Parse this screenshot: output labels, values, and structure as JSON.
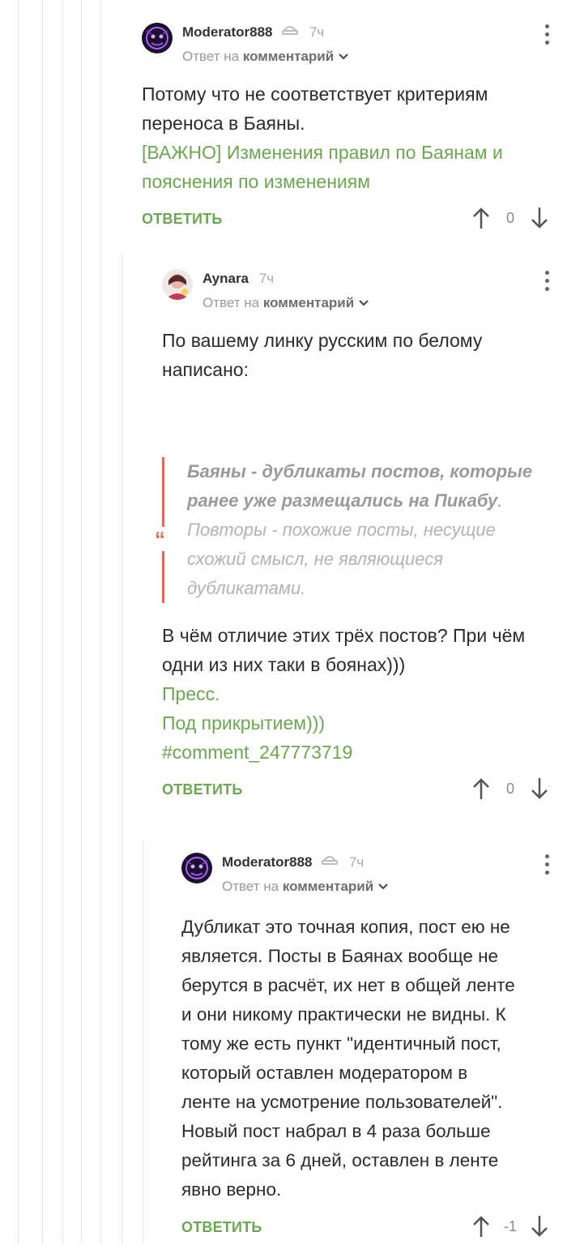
{
  "comments": [
    {
      "author": "Moderator888",
      "time": "7ч",
      "reply_prefix": "Ответ на",
      "reply_target": "комментарий",
      "text_lines": [
        "Потому что не соответствует критериям",
        "переноса в Баяны."
      ],
      "link_lines": [
        "[ВАЖНО] Изменения правил по Баянам и",
        "пояснения по изменениям"
      ],
      "reply_label": "ОТВЕТИТЬ",
      "score": "0"
    },
    {
      "author": "Aynara",
      "time": "7ч",
      "reply_prefix": "Ответ на",
      "reply_target": "комментарий",
      "text_lines": [
        "По вашему линку русским по белому",
        "написано:"
      ],
      "quote": {
        "line1": "Баяны - дубликаты постов, которые",
        "line2": "ранее уже размещались на Пикабу",
        "line2_end": ".",
        "line3": "Повторы - похожие посты, несущие",
        "line4": "схожий смысл, не являющиеся",
        "line5": "дубликатами."
      },
      "after_lines": [
        "В чём отличие этих трёх постов? При чём",
        "одни из них таки в боянах)))"
      ],
      "links": [
        "Пресс.",
        "Под прикрытием)))",
        "#comment_247773719"
      ],
      "reply_label": "ОТВЕТИТЬ",
      "score": "0"
    },
    {
      "author": "Moderator888",
      "time": "7ч",
      "reply_prefix": "Ответ на",
      "reply_target": "комментарий",
      "text_lines": [
        "Дубликат это точная копия, пост ею не",
        "является. Посты в Баянах вообще не",
        "берутся в расчёт, их нет в общей ленте",
        "и они никому практически не видны. К",
        "тому же есть пункт \"идентичный пост,",
        "который оставлен модератором в",
        "ленте на усмотрение пользователей\".",
        "Новый пост набрал в 4 раза больше",
        "рейтинга за 6 дней, оставлен в ленте",
        "явно верно."
      ],
      "reply_label": "ОТВЕТИТЬ",
      "score": "-1"
    }
  ],
  "colors": {
    "accent": "#6aa84f",
    "quote_bar": "#e46a5a"
  }
}
